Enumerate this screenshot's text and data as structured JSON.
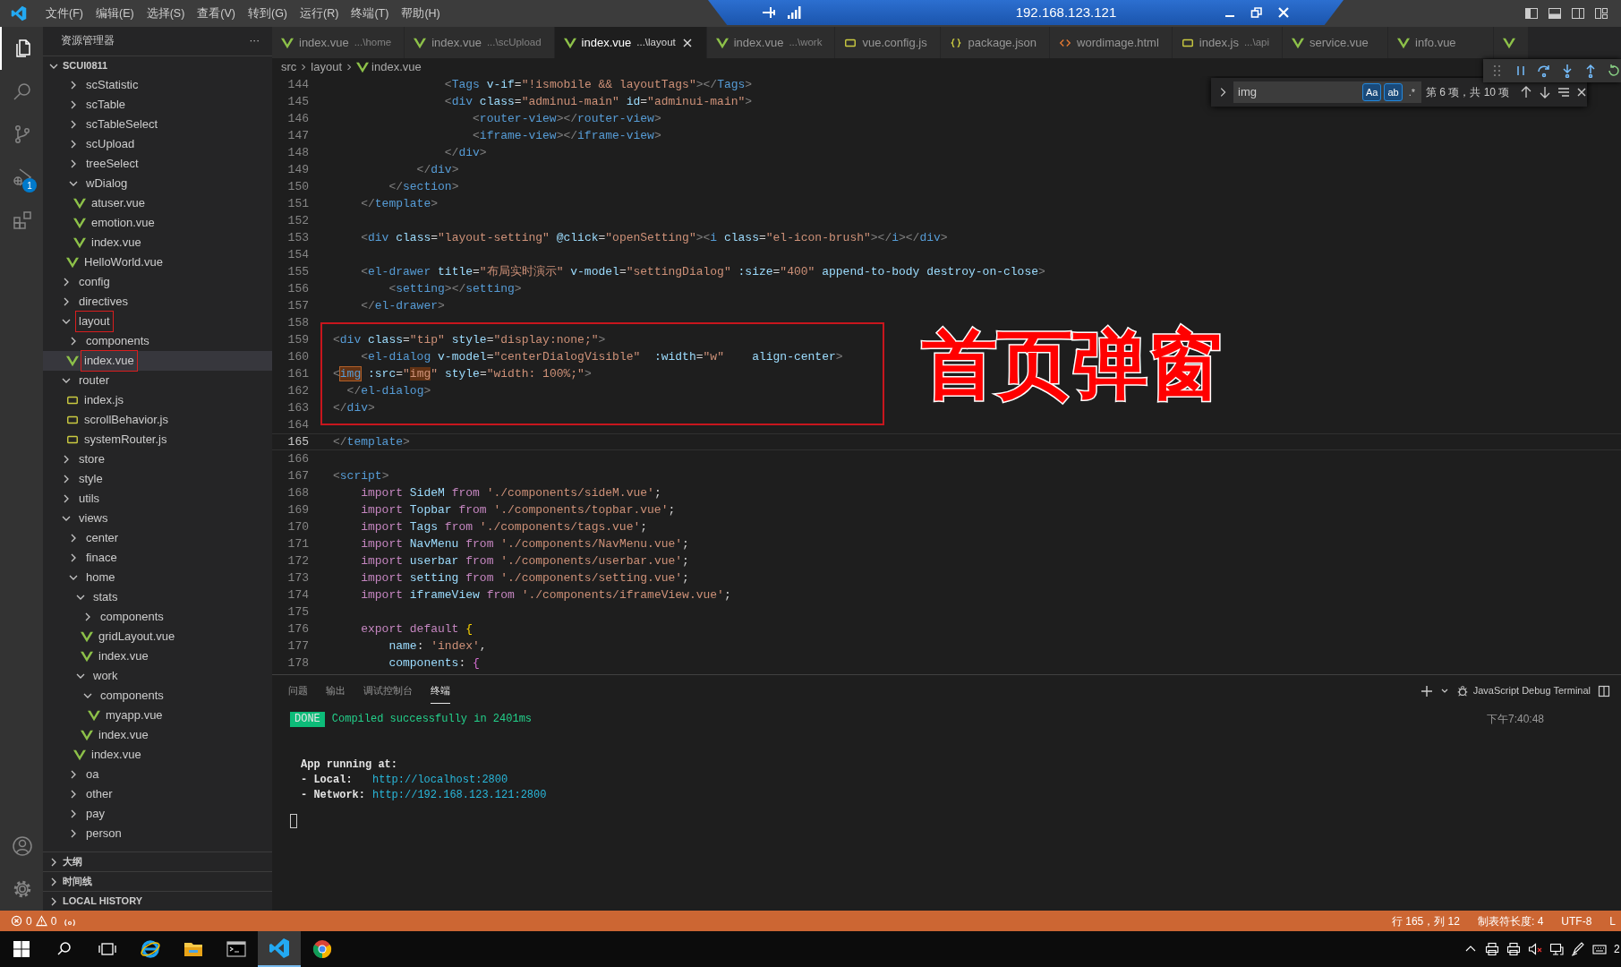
{
  "title_bar": {
    "menus": [
      "文件(F)",
      "编辑(E)",
      "选择(S)",
      "查看(V)",
      "转到(G)",
      "运行(R)",
      "终端(T)",
      "帮助(H)"
    ],
    "remote_host": "192.168.123.121"
  },
  "activity_bar": {
    "items": [
      {
        "kind": "explorer",
        "selected": true
      },
      {
        "kind": "search",
        "selected": false
      },
      {
        "kind": "source-control",
        "selected": false
      },
      {
        "kind": "run-debug",
        "selected": false,
        "badge": "1"
      },
      {
        "kind": "extensions",
        "selected": false
      }
    ],
    "bottom": [
      {
        "kind": "account"
      },
      {
        "kind": "settings"
      }
    ]
  },
  "sidebar": {
    "title": "资源管理器",
    "more": "···",
    "root": {
      "label": "SCUI0811",
      "expanded": true
    },
    "tree": [
      {
        "kind": "group",
        "children": [
          {
            "label": "scStatistic",
            "kind": "folder",
            "expanded": false,
            "selected": false,
            "annotated": false
          },
          {
            "label": "scTable",
            "kind": "folder",
            "expanded": false,
            "selected": false,
            "annotated": false
          },
          {
            "label": "scTableSelect",
            "kind": "folder",
            "expanded": false,
            "selected": false,
            "annotated": false
          },
          {
            "label": "scUpload",
            "kind": "folder",
            "expanded": false,
            "selected": false,
            "annotated": false
          },
          {
            "label": "treeSelect",
            "kind": "folder",
            "expanded": false,
            "selected": false,
            "annotated": false
          },
          {
            "label": "wDialog",
            "kind": "folder",
            "expanded": true,
            "selected": false,
            "annotated": false,
            "children": [
              {
                "label": "atuser.vue",
                "kind": "vue",
                "selected": false,
                "annotated": false
              },
              {
                "label": "emotion.vue",
                "kind": "vue",
                "selected": false,
                "annotated": false
              },
              {
                "label": "index.vue",
                "kind": "vue",
                "selected": false,
                "annotated": false
              }
            ]
          },
          {
            "label": "HelloWorld.vue",
            "kind": "vue",
            "selected": false,
            "annotated": false
          }
        ]
      },
      {
        "label": "config",
        "kind": "folder",
        "expanded": false,
        "selected": false,
        "annotated": false
      },
      {
        "label": "directives",
        "kind": "folder",
        "expanded": false,
        "selected": false,
        "annotated": false
      },
      {
        "label": "layout",
        "kind": "folder",
        "expanded": true,
        "selected": false,
        "annotated": true,
        "children": [
          {
            "label": "components",
            "kind": "folder",
            "expanded": false,
            "selected": false,
            "annotated": false
          },
          {
            "label": "index.vue",
            "kind": "vue",
            "selected": true,
            "annotated": true
          }
        ]
      },
      {
        "label": "router",
        "kind": "folder",
        "expanded": true,
        "selected": false,
        "annotated": false,
        "children": [
          {
            "label": "index.js",
            "kind": "js",
            "selected": false,
            "annotated": false
          },
          {
            "label": "scrollBehavior.js",
            "kind": "js",
            "selected": false,
            "annotated": false
          },
          {
            "label": "systemRouter.js",
            "kind": "js",
            "selected": false,
            "annotated": false
          }
        ]
      },
      {
        "label": "store",
        "kind": "folder",
        "expanded": false,
        "selected": false,
        "annotated": false
      },
      {
        "label": "style",
        "kind": "folder",
        "expanded": false,
        "selected": false,
        "annotated": false
      },
      {
        "label": "utils",
        "kind": "folder",
        "expanded": false,
        "selected": false,
        "annotated": false
      },
      {
        "label": "views",
        "kind": "folder",
        "expanded": true,
        "selected": false,
        "annotated": false,
        "children": [
          {
            "label": "center",
            "kind": "folder",
            "expanded": false,
            "selected": false,
            "annotated": false
          },
          {
            "label": "finace",
            "kind": "folder",
            "expanded": false,
            "selected": false,
            "annotated": false
          },
          {
            "label": "home",
            "kind": "folder",
            "expanded": true,
            "selected": false,
            "annotated": false,
            "children": [
              {
                "label": "stats",
                "kind": "folder",
                "expanded": true,
                "selected": false,
                "annotated": false,
                "children": [
                  {
                    "label": "components",
                    "kind": "folder",
                    "expanded": false,
                    "selected": false,
                    "annotated": false
                  },
                  {
                    "label": "gridLayout.vue",
                    "kind": "vue",
                    "selected": false,
                    "annotated": false
                  },
                  {
                    "label": "index.vue",
                    "kind": "vue",
                    "selected": false,
                    "annotated": false
                  }
                ]
              },
              {
                "label": "work",
                "kind": "folder",
                "expanded": true,
                "selected": false,
                "annotated": false,
                "children": [
                  {
                    "label": "components",
                    "kind": "folder",
                    "expanded": true,
                    "selected": false,
                    "annotated": false,
                    "children": [
                      {
                        "label": "myapp.vue",
                        "kind": "vue",
                        "selected": false,
                        "annotated": false
                      }
                    ]
                  },
                  {
                    "label": "index.vue",
                    "kind": "vue",
                    "selected": false,
                    "annotated": false
                  }
                ]
              },
              {
                "label": "index.vue",
                "kind": "vue",
                "selected": false,
                "annotated": false
              }
            ]
          },
          {
            "label": "oa",
            "kind": "folder",
            "expanded": false,
            "selected": false,
            "annotated": false
          },
          {
            "label": "other",
            "kind": "folder",
            "expanded": false,
            "selected": false,
            "annotated": false
          },
          {
            "label": "pay",
            "kind": "folder",
            "expanded": false,
            "selected": false,
            "annotated": false
          },
          {
            "label": "person",
            "kind": "folder",
            "expanded": false,
            "selected": false,
            "annotated": false
          }
        ]
      }
    ],
    "sections": [
      {
        "label": "大纲",
        "expanded": false
      },
      {
        "label": "时间线",
        "expanded": false
      },
      {
        "label": "LOCAL HISTORY",
        "expanded": false
      }
    ]
  },
  "editor": {
    "tabs": [
      {
        "label": "index.vue",
        "description": "...\\home",
        "kind": "vue",
        "selected": false
      },
      {
        "label": "index.vue",
        "description": "...\\scUpload",
        "kind": "vue",
        "selected": false
      },
      {
        "label": "index.vue",
        "description": "...\\layout",
        "kind": "vue",
        "selected": true
      },
      {
        "label": "index.vue",
        "description": "...\\work",
        "kind": "vue",
        "selected": false
      },
      {
        "label": "vue.config.js",
        "kind": "js",
        "selected": false
      },
      {
        "label": "package.json",
        "kind": "json",
        "selected": false
      },
      {
        "label": "wordimage.html",
        "kind": "html",
        "selected": false
      },
      {
        "label": "index.js",
        "description": "...\\api",
        "kind": "js",
        "selected": false
      },
      {
        "label": "service.vue",
        "kind": "vue",
        "selected": false
      },
      {
        "label": "info.vue",
        "kind": "vue",
        "selected": false
      },
      {
        "kind": "vue",
        "selected": false
      }
    ],
    "breadcrumb": [
      {
        "label": "src",
        "kind": "folder"
      },
      {
        "label": "layout",
        "kind": "folder"
      },
      {
        "label": "index.vue",
        "kind": "vue"
      }
    ],
    "find": {
      "value": "img",
      "options": [
        {
          "glyph": "Aa",
          "on": true
        },
        {
          "glyph": "ab",
          "on": true
        },
        {
          "glyph": ".*",
          "on": false
        }
      ],
      "result": "第 6 项，共 10 项"
    },
    "debug_toolbar": [
      {
        "kind": "grip"
      },
      {
        "kind": "pause"
      },
      {
        "kind": "step-over"
      },
      {
        "kind": "step-into"
      },
      {
        "kind": "step-out"
      },
      {
        "kind": "restart"
      }
    ],
    "caption": "首页弹窗",
    "lines": [
      {
        "number": "144",
        "current": false,
        "boxed": false,
        "segments": [
          {
            "kind": "p",
            "text": "                <"
          },
          {
            "kind": "tag",
            "text": "Tags"
          },
          {
            "kind": "attr",
            "text": " v-if"
          },
          {
            "kind": "txt",
            "text": "="
          },
          {
            "kind": "str",
            "text": "\"!ismobile && layoutTags\""
          },
          {
            "kind": "p",
            "text": "></"
          },
          {
            "kind": "tag",
            "text": "Tags"
          },
          {
            "kind": "p",
            "text": ">"
          }
        ]
      },
      {
        "number": "145",
        "current": false,
        "boxed": false,
        "segments": [
          {
            "kind": "p",
            "text": "                <"
          },
          {
            "kind": "tag",
            "text": "div"
          },
          {
            "kind": "attr",
            "text": " class"
          },
          {
            "kind": "txt",
            "text": "="
          },
          {
            "kind": "str",
            "text": "\"adminui-main\""
          },
          {
            "kind": "attr",
            "text": " id"
          },
          {
            "kind": "txt",
            "text": "="
          },
          {
            "kind": "str",
            "text": "\"adminui-main\""
          },
          {
            "kind": "p",
            "text": ">"
          }
        ]
      },
      {
        "number": "146",
        "current": false,
        "boxed": false,
        "segments": [
          {
            "kind": "p",
            "text": "                    <"
          },
          {
            "kind": "tag",
            "text": "router-view"
          },
          {
            "kind": "p",
            "text": "></"
          },
          {
            "kind": "tag",
            "text": "router-view"
          },
          {
            "kind": "p",
            "text": ">"
          }
        ]
      },
      {
        "number": "147",
        "current": false,
        "boxed": false,
        "segments": [
          {
            "kind": "p",
            "text": "                    <"
          },
          {
            "kind": "tag",
            "text": "iframe-view"
          },
          {
            "kind": "p",
            "text": "></"
          },
          {
            "kind": "tag",
            "text": "iframe-view"
          },
          {
            "kind": "p",
            "text": ">"
          }
        ]
      },
      {
        "number": "148",
        "current": false,
        "boxed": false,
        "segments": [
          {
            "kind": "p",
            "text": "                </"
          },
          {
            "kind": "tag",
            "text": "div"
          },
          {
            "kind": "p",
            "text": ">"
          }
        ]
      },
      {
        "number": "149",
        "current": false,
        "boxed": false,
        "segments": [
          {
            "kind": "p",
            "text": "            </"
          },
          {
            "kind": "tag",
            "text": "div"
          },
          {
            "kind": "p",
            "text": ">"
          }
        ]
      },
      {
        "number": "150",
        "current": false,
        "boxed": false,
        "segments": [
          {
            "kind": "p",
            "text": "        </"
          },
          {
            "kind": "tag",
            "text": "section"
          },
          {
            "kind": "p",
            "text": ">"
          }
        ]
      },
      {
        "number": "151",
        "current": false,
        "boxed": false,
        "segments": [
          {
            "kind": "p",
            "text": "    </"
          },
          {
            "kind": "tag",
            "text": "template"
          },
          {
            "kind": "p",
            "text": ">"
          }
        ]
      },
      {
        "number": "152",
        "current": false,
        "boxed": false
      },
      {
        "number": "153",
        "current": false,
        "boxed": false,
        "segments": [
          {
            "kind": "p",
            "text": "    <"
          },
          {
            "kind": "tag",
            "text": "div"
          },
          {
            "kind": "attr",
            "text": " class"
          },
          {
            "kind": "txt",
            "text": "="
          },
          {
            "kind": "str",
            "text": "\"layout-setting\""
          },
          {
            "kind": "attr",
            "text": " @click"
          },
          {
            "kind": "txt",
            "text": "="
          },
          {
            "kind": "str",
            "text": "\"openSetting\""
          },
          {
            "kind": "p",
            "text": "><"
          },
          {
            "kind": "tag",
            "text": "i"
          },
          {
            "kind": "attr",
            "text": " class"
          },
          {
            "kind": "txt",
            "text": "="
          },
          {
            "kind": "str",
            "text": "\"el-icon-brush\""
          },
          {
            "kind": "p",
            "text": "></"
          },
          {
            "kind": "tag",
            "text": "i"
          },
          {
            "kind": "p",
            "text": "></"
          },
          {
            "kind": "tag",
            "text": "div"
          },
          {
            "kind": "p",
            "text": ">"
          }
        ]
      },
      {
        "number": "154",
        "current": false,
        "boxed": false
      },
      {
        "number": "155",
        "current": false,
        "boxed": false,
        "segments": [
          {
            "kind": "p",
            "text": "    <"
          },
          {
            "kind": "tag",
            "text": "el-drawer"
          },
          {
            "kind": "attr",
            "text": " title"
          },
          {
            "kind": "txt",
            "text": "="
          },
          {
            "kind": "str",
            "text": "\"布局实时演示\""
          },
          {
            "kind": "attr",
            "text": " v-model"
          },
          {
            "kind": "txt",
            "text": "="
          },
          {
            "kind": "str",
            "text": "\"settingDialog\""
          },
          {
            "kind": "attr",
            "text": " :size"
          },
          {
            "kind": "txt",
            "text": "="
          },
          {
            "kind": "str",
            "text": "\"400\""
          },
          {
            "kind": "attr",
            "text": " append-to-body destroy-on-close"
          },
          {
            "kind": "p",
            "text": ">"
          }
        ]
      },
      {
        "number": "156",
        "current": false,
        "boxed": false,
        "segments": [
          {
            "kind": "p",
            "text": "        <"
          },
          {
            "kind": "tag",
            "text": "setting"
          },
          {
            "kind": "p",
            "text": "></"
          },
          {
            "kind": "tag",
            "text": "setting"
          },
          {
            "kind": "p",
            "text": ">"
          }
        ]
      },
      {
        "number": "157",
        "current": false,
        "boxed": false,
        "segments": [
          {
            "kind": "p",
            "text": "    </"
          },
          {
            "kind": "tag",
            "text": "el-drawer"
          },
          {
            "kind": "p",
            "text": ">"
          }
        ]
      },
      {
        "number": "158",
        "current": false,
        "boxed": true
      },
      {
        "number": "159",
        "current": false,
        "boxed": true,
        "segments": [
          {
            "kind": "p",
            "text": "<"
          },
          {
            "kind": "tag",
            "text": "div"
          },
          {
            "kind": "attr",
            "text": " class"
          },
          {
            "kind": "txt",
            "text": "="
          },
          {
            "kind": "str",
            "text": "\"tip\""
          },
          {
            "kind": "attr",
            "text": " style"
          },
          {
            "kind": "txt",
            "text": "="
          },
          {
            "kind": "str",
            "text": "\"display:none;\""
          },
          {
            "kind": "p",
            "text": ">"
          }
        ]
      },
      {
        "number": "160",
        "current": false,
        "boxed": true,
        "segments": [
          {
            "kind": "p",
            "text": "    <"
          },
          {
            "kind": "tag",
            "text": "el-dialog"
          },
          {
            "kind": "attr",
            "text": " v-model"
          },
          {
            "kind": "txt",
            "text": "="
          },
          {
            "kind": "str",
            "text": "\"centerDialogVisible\""
          },
          {
            "kind": "attr",
            "text": "  :width"
          },
          {
            "kind": "txt",
            "text": "="
          },
          {
            "kind": "str",
            "text": "\"w\""
          },
          {
            "kind": "attr",
            "text": "    align-center"
          },
          {
            "kind": "p",
            "text": ">"
          }
        ]
      },
      {
        "number": "161",
        "current": false,
        "boxed": true,
        "segments": [
          {
            "kind": "p",
            "text": "<"
          },
          {
            "kind": "match",
            "text": "img"
          },
          {
            "kind": "attr",
            "text": " :src"
          },
          {
            "kind": "txt",
            "text": "="
          },
          {
            "kind": "str",
            "text": "\""
          },
          {
            "kind": "strmatch",
            "text": "img"
          },
          {
            "kind": "str",
            "text": "\""
          },
          {
            "kind": "attr",
            "text": " style"
          },
          {
            "kind": "txt",
            "text": "="
          },
          {
            "kind": "str",
            "text": "\"width: 100%;\""
          },
          {
            "kind": "p",
            "text": ">"
          }
        ]
      },
      {
        "number": "162",
        "current": false,
        "boxed": true,
        "segments": [
          {
            "kind": "p",
            "text": "  </"
          },
          {
            "kind": "tag",
            "text": "el-dialog"
          },
          {
            "kind": "p",
            "text": ">"
          }
        ]
      },
      {
        "number": "163",
        "current": false,
        "boxed": true,
        "segments": [
          {
            "kind": "p",
            "text": "</"
          },
          {
            "kind": "tag",
            "text": "div"
          },
          {
            "kind": "p",
            "text": ">"
          }
        ]
      },
      {
        "number": "164",
        "current": false,
        "boxed": true
      },
      {
        "number": "165",
        "current": true,
        "boxed": false,
        "segments": [
          {
            "kind": "p",
            "text": "</"
          },
          {
            "kind": "tag",
            "text": "template"
          },
          {
            "kind": "p",
            "text": ">"
          }
        ]
      },
      {
        "number": "166",
        "current": false,
        "boxed": false
      },
      {
        "number": "167",
        "current": false,
        "boxed": false,
        "segments": [
          {
            "kind": "p",
            "text": "<"
          },
          {
            "kind": "tag",
            "text": "script"
          },
          {
            "kind": "p",
            "text": ">"
          }
        ]
      },
      {
        "number": "168",
        "current": false,
        "boxed": false,
        "segments": [
          {
            "kind": "kw",
            "text": "    import"
          },
          {
            "kind": "var",
            "text": " SideM"
          },
          {
            "kind": "kw",
            "text": " from"
          },
          {
            "kind": "str",
            "text": " './components/sideM.vue'"
          },
          {
            "kind": "txt",
            "text": ";"
          }
        ]
      },
      {
        "number": "169",
        "current": false,
        "boxed": false,
        "segments": [
          {
            "kind": "kw",
            "text": "    import"
          },
          {
            "kind": "var",
            "text": " Topbar"
          },
          {
            "kind": "kw",
            "text": " from"
          },
          {
            "kind": "str",
            "text": " './components/topbar.vue'"
          },
          {
            "kind": "txt",
            "text": ";"
          }
        ]
      },
      {
        "number": "170",
        "current": false,
        "boxed": false,
        "segments": [
          {
            "kind": "kw",
            "text": "    import"
          },
          {
            "kind": "var",
            "text": " Tags"
          },
          {
            "kind": "kw",
            "text": " from"
          },
          {
            "kind": "str",
            "text": " './components/tags.vue'"
          },
          {
            "kind": "txt",
            "text": ";"
          }
        ]
      },
      {
        "number": "171",
        "current": false,
        "boxed": false,
        "segments": [
          {
            "kind": "kw",
            "text": "    import"
          },
          {
            "kind": "var",
            "text": " NavMenu"
          },
          {
            "kind": "kw",
            "text": " from"
          },
          {
            "kind": "str",
            "text": " './components/NavMenu.vue'"
          },
          {
            "kind": "txt",
            "text": ";"
          }
        ]
      },
      {
        "number": "172",
        "current": false,
        "boxed": false,
        "segments": [
          {
            "kind": "kw",
            "text": "    import"
          },
          {
            "kind": "var",
            "text": " userbar"
          },
          {
            "kind": "kw",
            "text": " from"
          },
          {
            "kind": "str",
            "text": " './components/userbar.vue'"
          },
          {
            "kind": "txt",
            "text": ";"
          }
        ]
      },
      {
        "number": "173",
        "current": false,
        "boxed": false,
        "segments": [
          {
            "kind": "kw",
            "text": "    import"
          },
          {
            "kind": "var",
            "text": " setting"
          },
          {
            "kind": "kw",
            "text": " from"
          },
          {
            "kind": "str",
            "text": " './components/setting.vue'"
          },
          {
            "kind": "txt",
            "text": ";"
          }
        ]
      },
      {
        "number": "174",
        "current": false,
        "boxed": false,
        "segments": [
          {
            "kind": "kw",
            "text": "    import"
          },
          {
            "kind": "var",
            "text": " iframeView"
          },
          {
            "kind": "kw",
            "text": " from"
          },
          {
            "kind": "str",
            "text": " './components/iframeView.vue'"
          },
          {
            "kind": "txt",
            "text": ";"
          }
        ]
      },
      {
        "number": "175",
        "current": false,
        "boxed": false
      },
      {
        "number": "176",
        "current": false,
        "boxed": false,
        "segments": [
          {
            "kind": "kw",
            "text": "    export"
          },
          {
            "kind": "kw",
            "text": " default"
          },
          {
            "kind": "brace",
            "text": " {"
          }
        ]
      },
      {
        "number": "177",
        "current": false,
        "boxed": false,
        "segments": [
          {
            "kind": "var",
            "text": "        name"
          },
          {
            "kind": "txt",
            "text": ": "
          },
          {
            "kind": "str",
            "text": "'index'"
          },
          {
            "kind": "txt",
            "text": ","
          }
        ]
      },
      {
        "number": "178",
        "current": false,
        "boxed": false,
        "segments": [
          {
            "kind": "var",
            "text": "        components"
          },
          {
            "kind": "txt",
            "text": ": "
          },
          {
            "kind": "brace2",
            "text": "{"
          }
        ]
      }
    ]
  },
  "panel": {
    "tabs": [
      {
        "label": "问题",
        "selected": false
      },
      {
        "label": "输出",
        "selected": false
      },
      {
        "label": "调试控制台",
        "selected": false
      },
      {
        "label": "终端",
        "selected": true
      }
    ],
    "terminal_name": "JavaScript Debug Terminal",
    "terminal": {
      "badge": "DONE",
      "message": "Compiled successfully in 2401ms",
      "time": "下午7:40:48",
      "heading": "App running at:",
      "links": [
        {
          "label": "- Local:",
          "url": "http://localhost:2800"
        },
        {
          "label": "- Network:",
          "url": "http://192.168.123.121:2800"
        }
      ]
    }
  },
  "status_bar": {
    "errors": "0",
    "warnings": "0",
    "items": [
      "行 165，列 12",
      "制表符长度: 4",
      "UTF-8",
      "L"
    ]
  },
  "taskbar": {
    "apps": [
      {
        "kind": "ie",
        "active": false
      },
      {
        "kind": "files",
        "active": false
      },
      {
        "kind": "terminal",
        "active": false
      },
      {
        "kind": "vscode",
        "active": true
      },
      {
        "kind": "chrome",
        "active": false
      }
    ],
    "tray": [
      {
        "kind": "chevron-up"
      },
      {
        "kind": "printer"
      },
      {
        "kind": "printer"
      },
      {
        "kind": "speaker-muted"
      },
      {
        "kind": "network"
      },
      {
        "kind": "pen"
      },
      {
        "kind": "keyboard"
      }
    ],
    "clock": "2"
  }
}
